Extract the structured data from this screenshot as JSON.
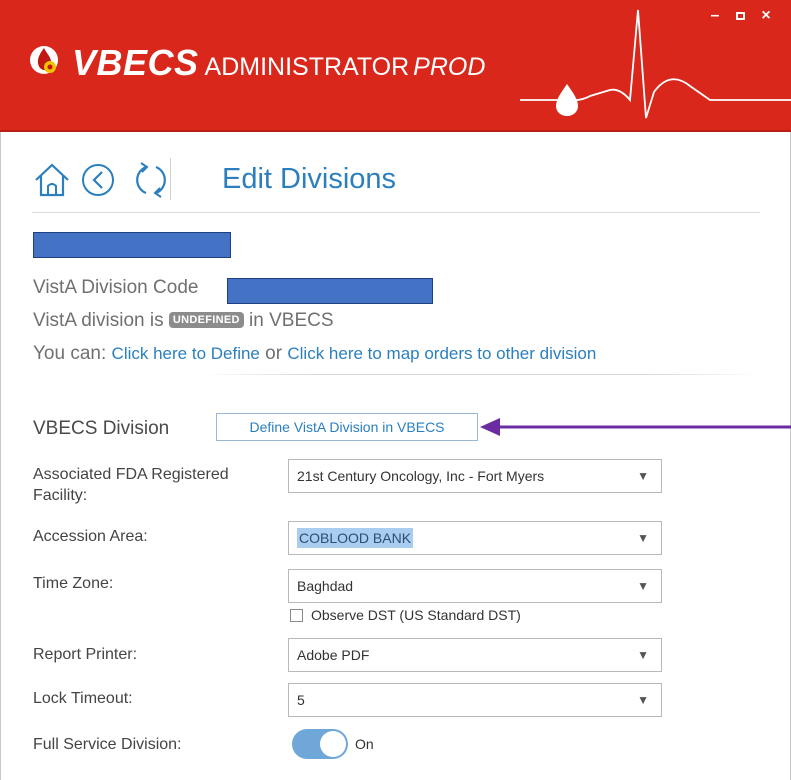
{
  "window": {
    "app_name": "VBECS",
    "app_subtitle": "ADMINISTRATOR",
    "environment": "PROD",
    "controls": {
      "minimize": "–",
      "maximize": "□",
      "close": "×"
    },
    "accent_color": "#d9271c"
  },
  "nav": {
    "icons": [
      "home-icon",
      "back-icon",
      "refresh-icon"
    ],
    "page_title": "Edit Divisions"
  },
  "division_info": {
    "code_label": "VistA Division Code",
    "state_prefix": "VistA division is",
    "state_badge": "UNDEFINED",
    "state_suffix": "in VBECS",
    "actions_prefix": "You can:",
    "define_link": "Click here to Define",
    "or_text": "or",
    "map_link": "Click here to map orders to other division"
  },
  "form": {
    "section_title": "VBECS Division",
    "define_button": "Define VistA Division in VBECS",
    "fields": {
      "fda_label": "Associated FDA Registered Facility:",
      "fda_value": "21st Century Oncology, Inc - Fort Myers",
      "accession_label": "Accession Area:",
      "accession_value": "COBLOOD BANK",
      "timezone_label": "Time Zone:",
      "timezone_value": "Baghdad",
      "dst_label": "Observe DST (US Standard DST)",
      "dst_checked": false,
      "printer_label": "Report Printer:",
      "printer_value": "Adobe PDF",
      "lock_label": "Lock Timeout:",
      "lock_value": "5",
      "full_service_label": "Full Service Division:",
      "full_service_state": "On",
      "full_service_on": true
    }
  },
  "annotation": {
    "arrow_color": "#6a2ca0"
  }
}
